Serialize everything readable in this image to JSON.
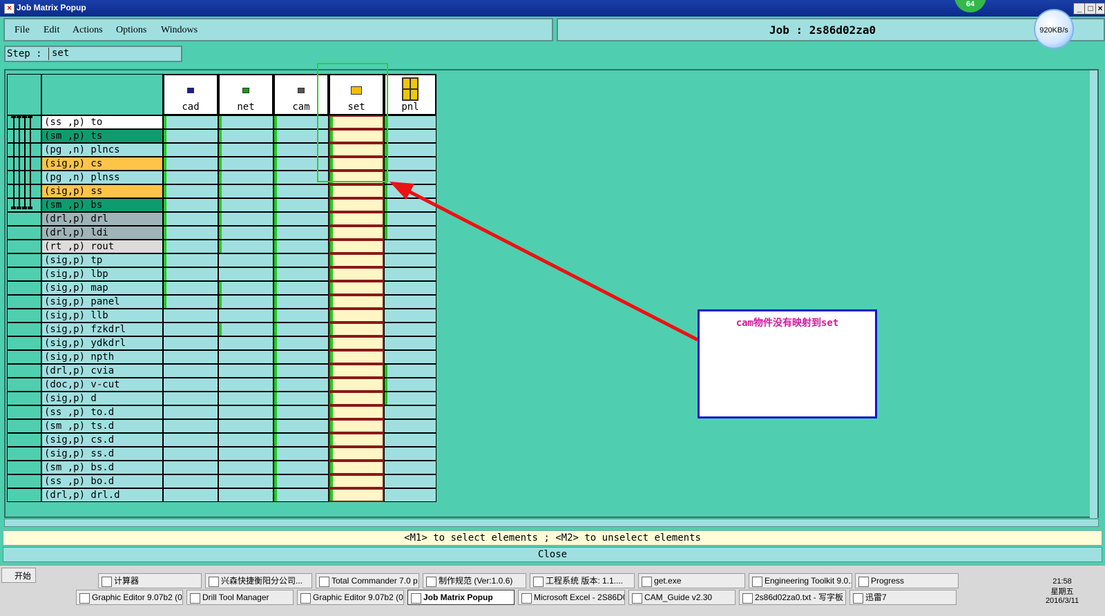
{
  "window": {
    "title": "Job Matrix Popup",
    "badge": "64",
    "speed": "920KB/s"
  },
  "menu": [
    "File",
    "Edit",
    "Actions",
    "Options",
    "Windows"
  ],
  "job": {
    "label": "Job  :  2s86d02za0"
  },
  "step": {
    "label": "Step :",
    "value": "set"
  },
  "columns": [
    "cad",
    "net",
    "cam",
    "set",
    "pnl"
  ],
  "layers": [
    {
      "name": "(ss ,p) to",
      "color": "#ffffff",
      "marks": [
        1,
        1,
        1,
        1,
        1
      ]
    },
    {
      "name": "(sm ,p) ts",
      "color": "#0e9c6e",
      "marks": [
        1,
        1,
        1,
        1,
        1
      ]
    },
    {
      "name": "(pg ,n) plncs",
      "color": "#a0dfe0",
      "marks": [
        1,
        1,
        1,
        1,
        1
      ]
    },
    {
      "name": "(sig,p) cs",
      "color": "#ffc34a",
      "marks": [
        1,
        1,
        1,
        1,
        1
      ]
    },
    {
      "name": "(pg ,n) plnss",
      "color": "#a0dfe0",
      "marks": [
        1,
        1,
        1,
        1,
        1
      ]
    },
    {
      "name": "(sig,p) ss",
      "color": "#ffc34a",
      "marks": [
        1,
        1,
        1,
        1,
        1
      ]
    },
    {
      "name": "(sm ,p) bs",
      "color": "#0e9c6e",
      "marks": [
        1,
        1,
        1,
        1,
        1
      ]
    },
    {
      "name": "(drl,p) drl",
      "color": "#9fb4b8",
      "marks": [
        1,
        1,
        1,
        1,
        1
      ]
    },
    {
      "name": "(drl,p) ldi",
      "color": "#9fb4b8",
      "marks": [
        1,
        1,
        1,
        1,
        1
      ]
    },
    {
      "name": "(rt ,p) rout",
      "color": "#dcdcdc",
      "marks": [
        1,
        1,
        1,
        1,
        0
      ]
    },
    {
      "name": "(sig,p) tp",
      "color": "#a0dfe0",
      "marks": [
        1,
        0,
        1,
        1,
        0
      ]
    },
    {
      "name": "(sig,p) lbp",
      "color": "#a0dfe0",
      "marks": [
        1,
        0,
        1,
        1,
        0
      ]
    },
    {
      "name": "(sig,p) map",
      "color": "#a0dfe0",
      "marks": [
        1,
        1,
        1,
        1,
        0
      ]
    },
    {
      "name": "(sig,p) panel",
      "color": "#a0dfe0",
      "marks": [
        1,
        1,
        1,
        1,
        0
      ]
    },
    {
      "name": "(sig,p) llb",
      "color": "#a0dfe0",
      "marks": [
        0,
        0,
        1,
        1,
        0
      ]
    },
    {
      "name": "(sig,p) fzkdrl",
      "color": "#a0dfe0",
      "marks": [
        0,
        1,
        1,
        1,
        0
      ]
    },
    {
      "name": "(sig,p) ydkdrl",
      "color": "#a0dfe0",
      "marks": [
        0,
        0,
        1,
        1,
        0
      ]
    },
    {
      "name": "(sig,p) npth",
      "color": "#a0dfe0",
      "marks": [
        0,
        0,
        1,
        1,
        0
      ]
    },
    {
      "name": "(drl,p) cvia",
      "color": "#a0dfe0",
      "marks": [
        0,
        0,
        1,
        1,
        1
      ]
    },
    {
      "name": "(doc,p) v-cut",
      "color": "#a0dfe0",
      "marks": [
        0,
        0,
        1,
        1,
        1
      ]
    },
    {
      "name": "(sig,p) d",
      "color": "#a0dfe0",
      "marks": [
        0,
        0,
        1,
        1,
        1
      ]
    },
    {
      "name": "(ss ,p) to.d",
      "color": "#a0dfe0",
      "marks": [
        0,
        0,
        1,
        1,
        0
      ]
    },
    {
      "name": "(sm ,p) ts.d",
      "color": "#a0dfe0",
      "marks": [
        0,
        0,
        1,
        1,
        0
      ]
    },
    {
      "name": "(sig,p) cs.d",
      "color": "#a0dfe0",
      "marks": [
        0,
        0,
        1,
        1,
        0
      ]
    },
    {
      "name": "(sig,p) ss.d",
      "color": "#a0dfe0",
      "marks": [
        0,
        0,
        1,
        1,
        0
      ]
    },
    {
      "name": "(sm ,p) bs.d",
      "color": "#a0dfe0",
      "marks": [
        0,
        0,
        1,
        1,
        0
      ]
    },
    {
      "name": "(ss ,p) bo.d",
      "color": "#a0dfe0",
      "marks": [
        0,
        0,
        1,
        1,
        0
      ]
    },
    {
      "name": "(drl,p) drl.d",
      "color": "#a0dfe0",
      "marks": [
        0,
        0,
        1,
        1,
        0
      ]
    }
  ],
  "annotation": {
    "text": "cam物件没有映射到set"
  },
  "hint": "<M1> to select elements ; <M2> to unselect elements",
  "close_label": "Close",
  "taskbar": {
    "start": "开始",
    "row1": [
      "计算器",
      "兴森快捷衡阳分公司...",
      "Total Commander 7.0 p...",
      "制作规范 (Ver:1.0.6)",
      "工程系统  版本: 1.1....",
      "get.exe",
      "Engineering Toolkit 9.0...",
      "Progress"
    ],
    "row2": [
      "Graphic Editor 9.07b2 (0...",
      "Drill Tool Manager",
      "Graphic Editor 9.07b2 (0...",
      "Job Matrix Popup",
      "Microsoft Excel - 2S86D0...",
      "CAM_Guide v2.30",
      "2s86d02za0.txt - 写字板",
      "迅雷7"
    ],
    "time": "21:58",
    "weekday": "星期五",
    "date": "2016/3/11"
  }
}
